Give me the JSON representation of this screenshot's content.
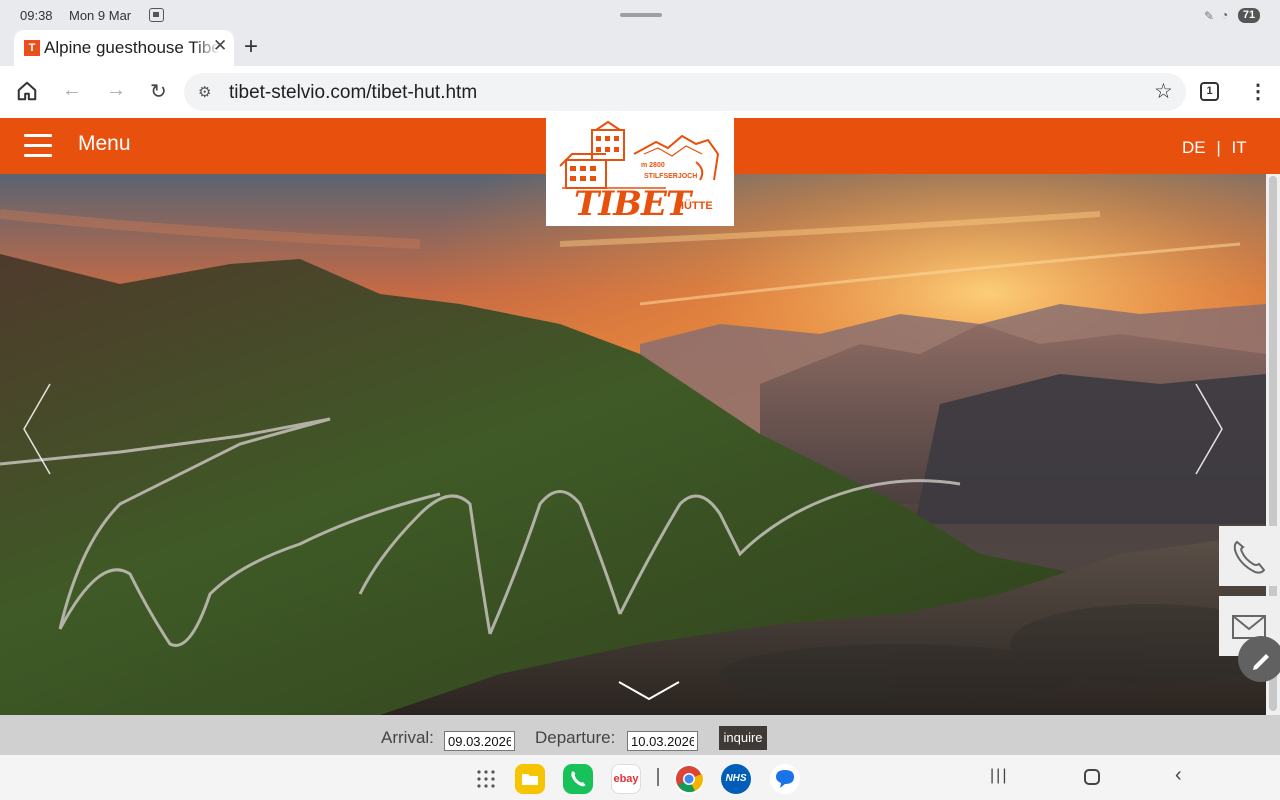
{
  "status_bar": {
    "time": "09:38",
    "date": "Mon 9 Mar",
    "battery": "71"
  },
  "browser": {
    "tab_title": "Alpine guesthouse Tibet Hut",
    "favicon_letter": "T",
    "url": "tibet-stelvio.com/tibet-hut.htm",
    "open_tabs": "1"
  },
  "site": {
    "menu_label": "Menu",
    "lang_de": "DE",
    "lang_sep": "|",
    "lang_it": "IT",
    "logo": {
      "name": "TIBET",
      "sub": "HÜTTE",
      "altitude": "m 2800",
      "pass": "STILFSERJOCH"
    },
    "booking": {
      "arrival_label": "Arrival:",
      "arrival_value": "09.03.2026",
      "departure_label": "Departure:",
      "departure_value": "10.03.2026",
      "inquire_label": "inquire"
    }
  },
  "colors": {
    "brand_orange": "#e8510d",
    "inquire_bg": "#3f3a36"
  },
  "dock": {
    "ebay": "ebay",
    "nhs": "NHS"
  }
}
